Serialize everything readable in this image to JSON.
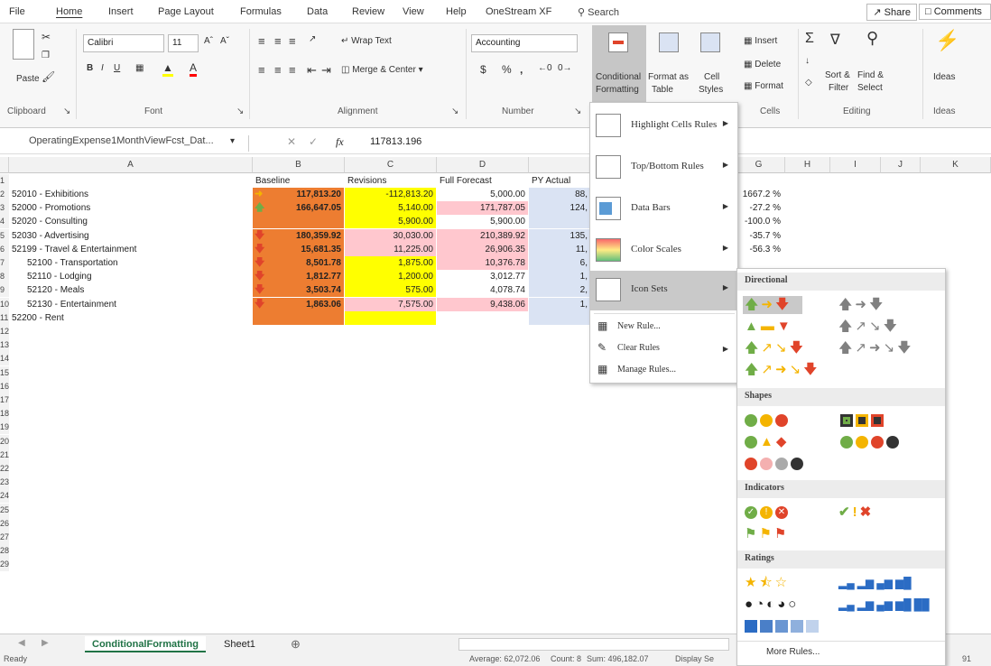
{
  "menu_tabs": [
    "File",
    "Home",
    "Insert",
    "Page Layout",
    "Formulas",
    "Data",
    "Review",
    "View",
    "Help",
    "OneStream XF"
  ],
  "search_label": "Search",
  "share_label": "Share",
  "comments_label": "Comments",
  "ribbon": {
    "clipboard": {
      "paste": "Paste",
      "label": "Clipboard"
    },
    "font": {
      "name": "Calibri",
      "size": "11",
      "label": "Font"
    },
    "alignment": {
      "wrap": "Wrap Text",
      "merge": "Merge & Center",
      "label": "Alignment"
    },
    "number": {
      "format": "Accounting",
      "label": "Number",
      "currency": "$",
      "percent": "%",
      "comma": ","
    },
    "styles": {
      "cond_line1": "Conditional",
      "cond_line2": "Formatting",
      "table_line1": "Format as",
      "table_line2": "Table",
      "cell_line1": "Cell",
      "cell_line2": "Styles"
    },
    "cells": {
      "insert": "Insert",
      "delete": "Delete",
      "format": "Format",
      "label": "Cells"
    },
    "editing": {
      "sort_line1": "Sort &",
      "sort_line2": "Filter",
      "find_line1": "Find &",
      "find_line2": "Select",
      "label": "Editing"
    },
    "ideas": {
      "btn": "Ideas",
      "label": "Ideas"
    }
  },
  "namebox": "OperatingExpense1MonthViewFcst_Dat...",
  "formula_value": "117813.196",
  "columns": [
    "A",
    "B",
    "C",
    "D",
    "E",
    "F",
    "G",
    "H",
    "I",
    "J",
    "K"
  ],
  "header_row": {
    "b": "Baseline",
    "c": "Revisions",
    "d": "Full Forecast",
    "e": "PY Actual"
  },
  "rows": [
    {
      "n": "2",
      "a": "52010 - Exhibitions",
      "b": "117,813.20",
      "c": "-112,813.20",
      "d": "5,000.00",
      "e": "88,",
      "g": "1667.2 %"
    },
    {
      "n": "3",
      "a": "52000 - Promotions",
      "b": "166,647.05",
      "c": "5,140.00",
      "d": "171,787.05",
      "e": "124,",
      "g": "-27.2 %"
    },
    {
      "n": "4",
      "a": "52020 - Consulting",
      "b": "",
      "c": "5,900.00",
      "d": "5,900.00",
      "e": "",
      "g": "-100.0 %"
    },
    {
      "n": "5",
      "a": "52030 - Advertising",
      "b": "180,359.92",
      "c": "30,030.00",
      "d": "210,389.92",
      "e": "135,",
      "g": "-35.7 %"
    },
    {
      "n": "6",
      "a": "52199 - Travel & Entertainment",
      "b": "15,681.35",
      "c": "11,225.00",
      "d": "26,906.35",
      "e": "11,",
      "g": "-56.3 %"
    },
    {
      "n": "7",
      "a": "52100 - Transportation",
      "b": "8,501.78",
      "c": "1,875.00",
      "d": "10,376.78",
      "e": "6,",
      "g": ""
    },
    {
      "n": "8",
      "a": "52110 - Lodging",
      "b": "1,812.77",
      "c": "1,200.00",
      "d": "3,012.77",
      "e": "1,",
      "g": ""
    },
    {
      "n": "9",
      "a": "52120 - Meals",
      "b": "3,503.74",
      "c": "575.00",
      "d": "4,078.74",
      "e": "2,",
      "g": ""
    },
    {
      "n": "10",
      "a": "52130 - Entertainment",
      "b": "1,863.06",
      "c": "7,575.00",
      "d": "9,438.06",
      "e": "1,",
      "g": ""
    },
    {
      "n": "11",
      "a": "52200 - Rent",
      "b": "",
      "c": "",
      "d": "",
      "e": "",
      "g": ""
    }
  ],
  "empty_rows": [
    "12",
    "13",
    "14",
    "15",
    "16",
    "17",
    "18",
    "19",
    "20",
    "21",
    "22",
    "23",
    "24",
    "25",
    "26",
    "27",
    "28",
    "29"
  ],
  "sheet_tabs": [
    "ConditionalFormatting",
    "Sheet1"
  ],
  "status": {
    "ready": "Ready",
    "average": "Average: 62,072.06",
    "count": "Count: 8",
    "sum": "Sum: 496,182.07",
    "display": "Display Se",
    "zoom": "91"
  },
  "cf_menu": {
    "highlight": "Highlight Cells Rules",
    "topbottom": "Top/Bottom Rules",
    "databars": "Data Bars",
    "colorscales": "Color Scales",
    "iconsets": "Icon Sets",
    "newrule": "New Rule...",
    "clearrules": "Clear Rules",
    "managerules": "Manage Rules..."
  },
  "iconsets_menu": {
    "directional": "Directional",
    "shapes": "Shapes",
    "indicators": "Indicators",
    "ratings": "Ratings",
    "more": "More Rules..."
  },
  "colors": {
    "green": "#70ad47",
    "yellow_icon": "#f4b400",
    "red": "#e0442a",
    "grey": "#808080",
    "orange_fill": "#ed7d31",
    "excel_green": "#217346"
  }
}
